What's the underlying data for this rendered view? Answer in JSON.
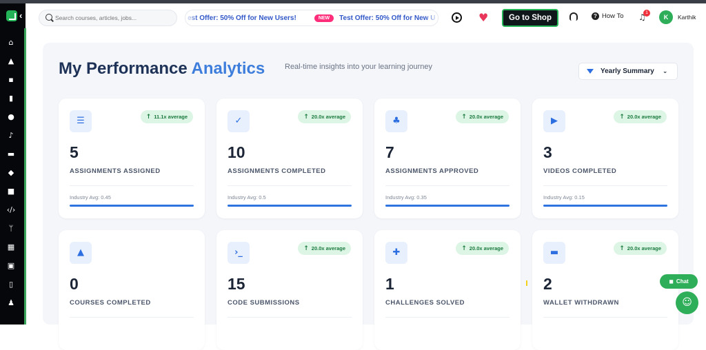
{
  "header": {
    "search_placeholder": "Search courses, articles, jobs...",
    "ticker_fragment": "est Offer: 50% Off for New Users!",
    "ticker_badge": "NEW",
    "ticker_text": "Test Offer: 50% Off for New U",
    "shop_button": "Go to Shop",
    "how_to": "How To",
    "notification_count": "1",
    "avatar_initial": "K",
    "user_name": "Karthik"
  },
  "page": {
    "title_main": "My Performance",
    "title_accent": "Analytics",
    "subtitle": "Real-time insights into your learning journey",
    "filter_label": "Yearly Summary"
  },
  "cards": [
    {
      "icon": "checklist-icon",
      "pill": "11.1x average",
      "value": "5",
      "label": "ASSIGNMENTS ASSIGNED",
      "industry": "Industry Avg: 0.45",
      "progress": 1.0
    },
    {
      "icon": "double-check-icon",
      "pill": "20.0x average",
      "value": "10",
      "label": "ASSIGNMENTS COMPLETED",
      "industry": "Industry Avg: 0.5",
      "progress": 1.0
    },
    {
      "icon": "thumbs-up-icon",
      "pill": "20.0x average",
      "value": "7",
      "label": "ASSIGNMENTS APPROVED",
      "industry": "Industry Avg: 0.35",
      "progress": 1.0
    },
    {
      "icon": "play-circle-icon",
      "pill": "20.0x average",
      "value": "3",
      "label": "VIDEOS COMPLETED",
      "industry": "Industry Avg: 0.15",
      "progress": 1.0
    },
    {
      "icon": "graduation-cap-icon",
      "pill": "",
      "value": "0",
      "label": "COURSES COMPLETED",
      "industry": "",
      "progress": 0
    },
    {
      "icon": "terminal-icon",
      "pill": "20.0x average",
      "value": "15",
      "label": "CODE SUBMISSIONS",
      "industry": "",
      "progress": 1.0
    },
    {
      "icon": "puzzle-icon",
      "pill": "20.0x average",
      "value": "1",
      "label": "CHALLENGES SOLVED",
      "industry": "",
      "progress": 1.0
    },
    {
      "icon": "wallet-icon",
      "pill": "20.0x average",
      "value": "2",
      "label": "WALLET WITHDRAWN",
      "industry": "",
      "progress": 1.0
    }
  ],
  "floating": {
    "chat_label": "Chat"
  },
  "colors": {
    "accent_blue": "#3d7ddb",
    "brand_green": "#2fae5a",
    "pill_bg": "#dcf5e4",
    "pill_text": "#1b7a3f"
  }
}
